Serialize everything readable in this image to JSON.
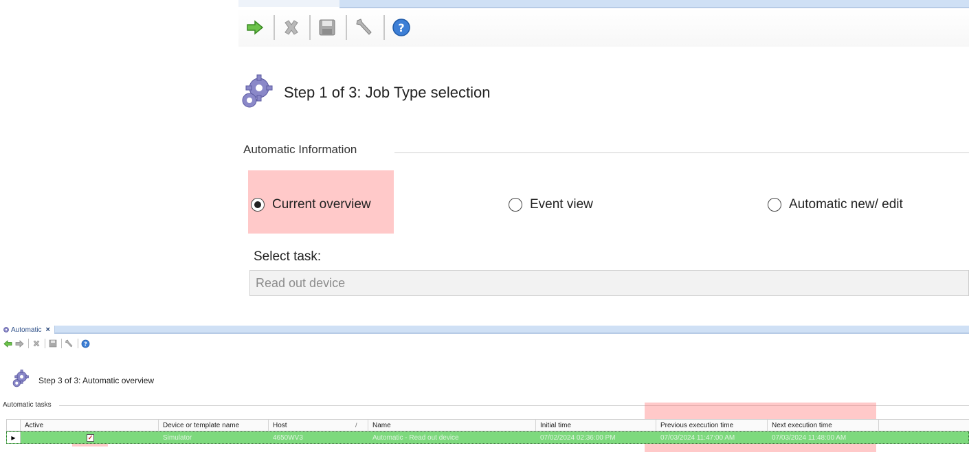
{
  "zoom_panel": {
    "heading": "Step 1 of 3: Job Type selection",
    "group_label": "Automatic Information",
    "radios": [
      {
        "label": "Current overview",
        "selected": true
      },
      {
        "label": "Event view",
        "selected": false
      },
      {
        "label": "Automatic new/ edit",
        "selected": false
      }
    ],
    "select_label": "Select task:",
    "select_value": "Read out device",
    "toolbar_icons": [
      "forward-arrow-icon",
      "delete-icon",
      "save-icon",
      "wrench-icon",
      "help-icon"
    ]
  },
  "small_panel": {
    "tab_label": "Automatic",
    "tab_close": "×",
    "heading": "Step 3 of 3: Automatic overview",
    "group_label": "Automatic tasks",
    "toolbar_icons": [
      "back-arrow-icon",
      "forward-arrow-icon",
      "delete-icon",
      "save-icon",
      "wrench-icon",
      "help-icon"
    ],
    "table": {
      "columns": [
        "Active",
        "Device or template name",
        "Host",
        "Name",
        "Initial time",
        "Previous execution time",
        "Next execution time"
      ],
      "sort_marker": "/",
      "rows": [
        {
          "row_marker": "▶",
          "active": true,
          "device": "Simulator",
          "host": "4650WV3",
          "name": "Automatic - Read out device",
          "initial_time": "07/02/2024 02:36:00 PM",
          "previous_time": "07/03/2024 11:47:00 AM",
          "next_time": "07/03/2024 11:48:00 AM"
        }
      ]
    }
  },
  "colors": {
    "highlight": "#ff7878",
    "row_selected": "#7dd97d",
    "tab_strip": "#cfe0f5"
  }
}
